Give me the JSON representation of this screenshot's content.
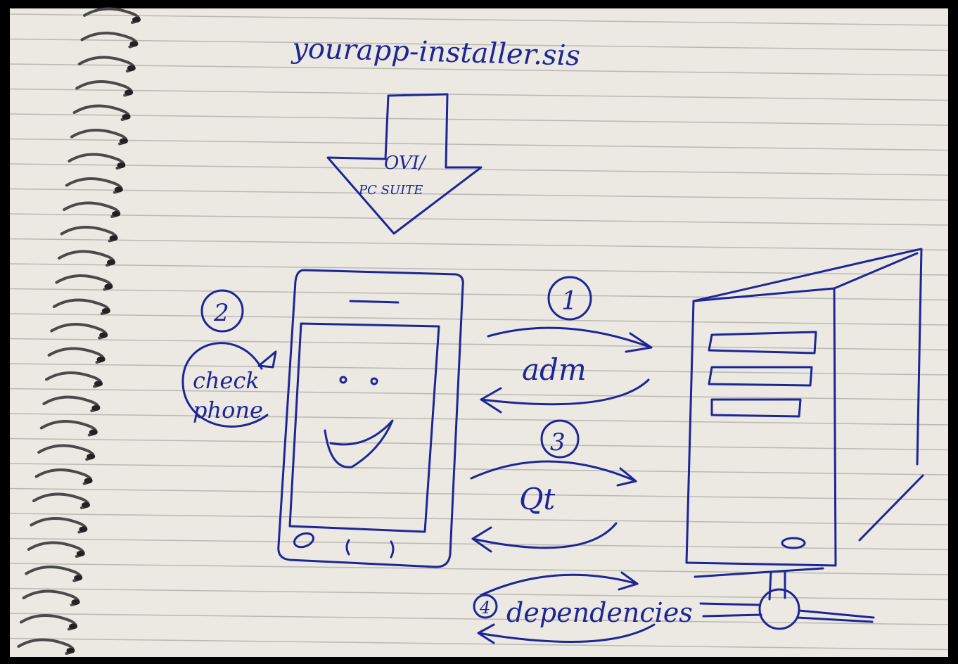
{
  "colors": {
    "paper": "#ebe9e1",
    "rule_line": "#b9b8b3",
    "ink": "#1e2596",
    "frame": "#000000",
    "spiral": "#4a4a4a"
  },
  "icons": {
    "download_arrow": "down-arrow-icon",
    "phone": "smartphone-icon",
    "computer": "desktop-tower-icon",
    "cycle": "circular-arrow-icon"
  },
  "diagram": {
    "file_name": "yourapp-installer.sis",
    "download_label_line1": "OVI/",
    "download_label_line2": "PC SUITE",
    "step2": {
      "number": "2",
      "label_line1": "check",
      "label_line2": "phone"
    },
    "step1": {
      "number": "1",
      "label": "adm"
    },
    "step3": {
      "number": "3",
      "label": "Qt"
    },
    "step4": {
      "number": "4",
      "label": "dependencies"
    }
  }
}
